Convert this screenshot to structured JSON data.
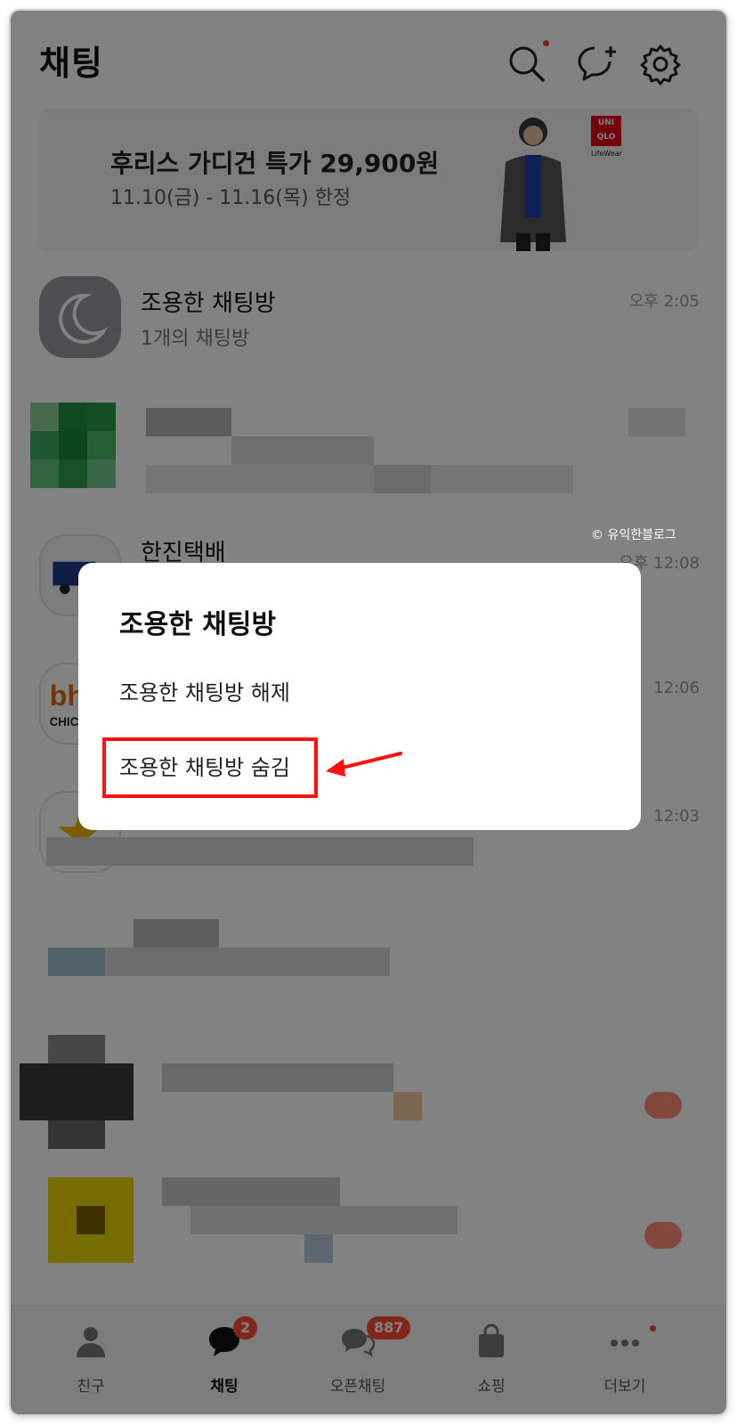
{
  "header": {
    "title": "채팅"
  },
  "banner": {
    "title": "후리스 가디건 특가 29,900원",
    "subtitle": "11.10(금) - 11.16(목) 한정",
    "logo_line1": "UNI",
    "logo_line2": "QLO",
    "logo_sub": "LifeWear"
  },
  "chats": [
    {
      "name": "조용한 채팅방",
      "preview": "1개의 채팅방",
      "time": "오후 2:05"
    },
    {
      "name": "한진택배",
      "time": "오후 12:08"
    },
    {
      "time": "12:06"
    },
    {
      "time": "12:03"
    }
  ],
  "tabs": [
    {
      "label": "친구"
    },
    {
      "label": "채팅",
      "badge": "2"
    },
    {
      "label": "오픈채팅",
      "badge": "887"
    },
    {
      "label": "쇼핑"
    },
    {
      "label": "더보기"
    }
  ],
  "dialog": {
    "title": "조용한 채팅방",
    "option_unset": "조용한 채팅방 해제",
    "option_hide": "조용한 채팅방 숨김"
  },
  "watermark": "© 유익한블로그",
  "colors": {
    "highlight": "#ff1010",
    "badge": "#ff4a36",
    "scrim": "rgba(0,0,0,0.49)"
  }
}
